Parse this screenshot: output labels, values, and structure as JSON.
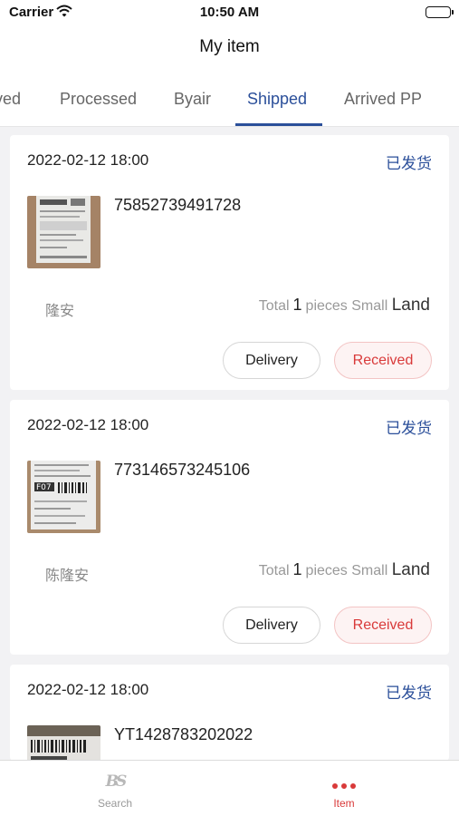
{
  "status_bar": {
    "carrier": "Carrier",
    "time": "10:50 AM"
  },
  "nav": {
    "title": "My item"
  },
  "tabs": [
    {
      "label": "ved"
    },
    {
      "label": "Processed"
    },
    {
      "label": "Byair"
    },
    {
      "label": "Shipped"
    },
    {
      "label": "Arrived PP"
    }
  ],
  "active_tab": "Shipped",
  "accent_color": "#2b4f9a",
  "danger_color": "#d93a3a",
  "orders": [
    {
      "date": "2022-02-12 18:00",
      "status": "已发货",
      "tracking": "75852739491728",
      "name": "隆安",
      "total_label": "Total",
      "count": "1",
      "pieces_label": "pieces",
      "size": "Small",
      "mode": "Land",
      "delivery_label": "Delivery",
      "received_label": "Received"
    },
    {
      "date": "2022-02-12 18:00",
      "status": "已发货",
      "tracking": "773146573245106",
      "name": "陈隆安",
      "total_label": "Total",
      "count": "1",
      "pieces_label": "pieces",
      "size": "Small",
      "mode": "Land",
      "delivery_label": "Delivery",
      "received_label": "Received"
    },
    {
      "date": "2022-02-12 18:00",
      "status": "已发货",
      "tracking": "YT1428783202022"
    }
  ],
  "tabbar": {
    "search_label": "Search",
    "item_label": "Item",
    "search_icon": "bs-logo-icon",
    "item_icon": "more-dots-icon"
  }
}
